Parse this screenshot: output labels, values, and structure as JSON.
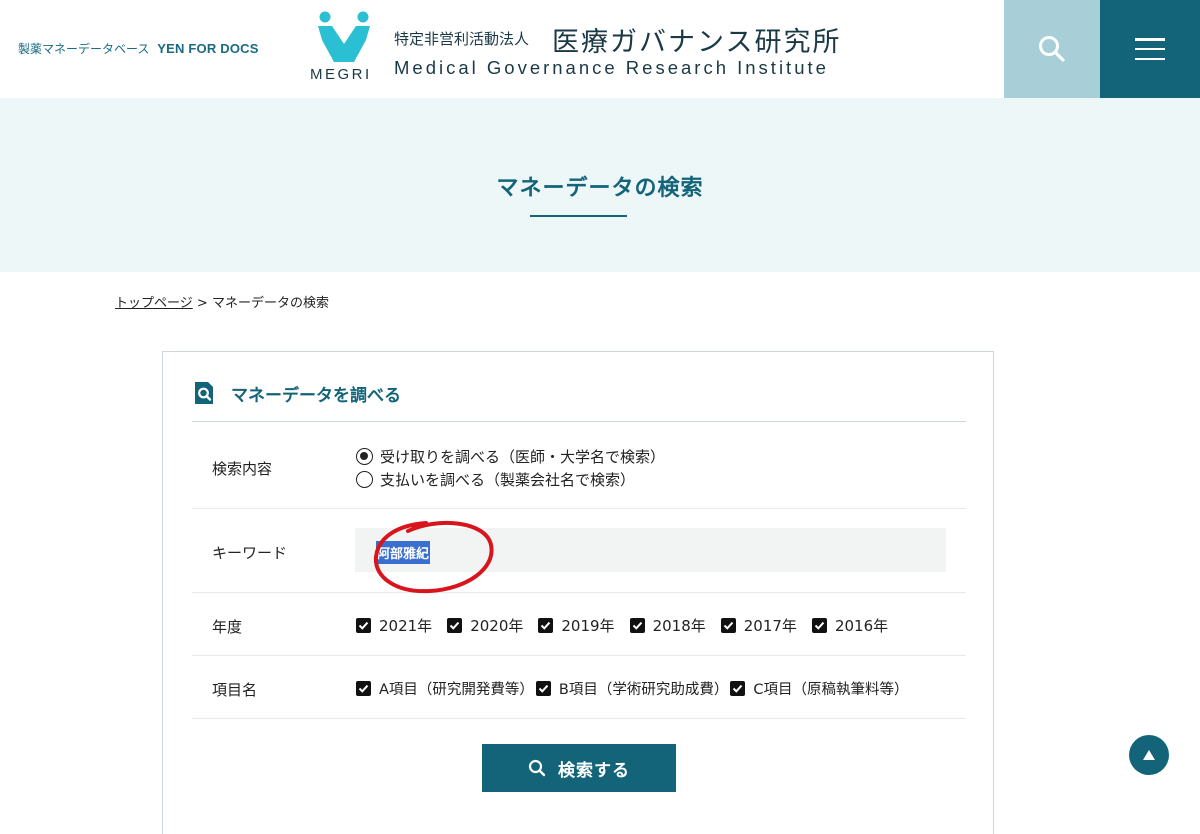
{
  "header": {
    "site_tag": "製薬マネーデータベース",
    "site_tag_en": "YEN FOR DOCS",
    "logo_text": "MEGRI",
    "org_kind": "特定非営利活動法人",
    "org_name": "医療ガバナンス研究所",
    "org_name_en": "Medical Governance Research Institute",
    "search_icon": "search-icon",
    "menu_icon": "hamburger-icon"
  },
  "colors": {
    "brand": "#136479",
    "brand_light": "#a8cfd8",
    "logo_cyan": "#2bbfd4",
    "band_bg": "#eef7f8",
    "annotation_red": "#d8141c"
  },
  "page_title": "マネーデータの検索",
  "breadcrumb": {
    "home": "トップページ",
    "separator": ">",
    "current": "マネーデータの検索"
  },
  "form": {
    "heading": "マネーデータを調べる",
    "search_type": {
      "label": "検索内容",
      "options": [
        {
          "label": "受け取りを調べる（医師・大学名で検索）",
          "selected": true
        },
        {
          "label": "支払いを調べる（製薬会社名で検索）",
          "selected": false
        }
      ]
    },
    "keyword": {
      "label": "キーワード",
      "value": "阿部雅紀"
    },
    "year": {
      "label": "年度",
      "options": [
        {
          "label": "2021年",
          "checked": true
        },
        {
          "label": "2020年",
          "checked": true
        },
        {
          "label": "2019年",
          "checked": true
        },
        {
          "label": "2018年",
          "checked": true
        },
        {
          "label": "2017年",
          "checked": true
        },
        {
          "label": "2016年",
          "checked": true
        }
      ]
    },
    "category": {
      "label": "項目名",
      "options": [
        {
          "label": "A項目（研究開発費等）",
          "checked": true
        },
        {
          "label": "B項目（学術研究助成費）",
          "checked": true
        },
        {
          "label": "C項目（原稿執筆料等）",
          "checked": true
        }
      ]
    },
    "submit_label": "検索する"
  }
}
